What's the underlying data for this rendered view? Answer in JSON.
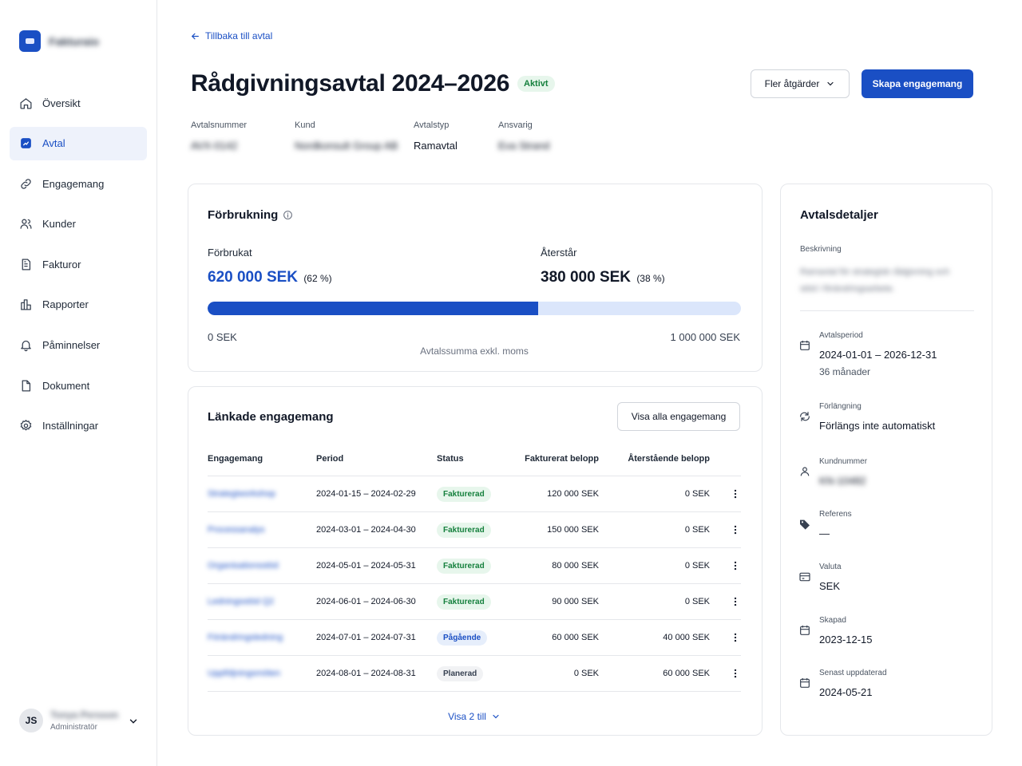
{
  "app": {
    "name": "Fakturaio"
  },
  "sidebar": {
    "items": [
      {
        "label": "Översikt",
        "icon": "home-icon"
      },
      {
        "label": "Avtal",
        "icon": "contract-icon",
        "active": true
      },
      {
        "label": "Engagemang",
        "icon": "link-icon"
      },
      {
        "label": "Kunder",
        "icon": "users-icon"
      },
      {
        "label": "Fakturor",
        "icon": "invoice-icon"
      },
      {
        "label": "Rapporter",
        "icon": "chart-icon"
      },
      {
        "label": "Påminnelser",
        "icon": "bell-icon"
      },
      {
        "label": "Dokument",
        "icon": "document-icon"
      },
      {
        "label": "Inställningar",
        "icon": "gear-icon"
      }
    ],
    "user": {
      "initials": "JS",
      "name": "Tonya Persson",
      "role": "Administratör"
    }
  },
  "header": {
    "back_label": "Tillbaka till avtal",
    "title": "Rådgivningsavtal 2024–2026",
    "status": "Aktivt",
    "more_actions": "Fler åtgärder",
    "create": "Skapa engagemang"
  },
  "meta": {
    "number": {
      "label": "Avtalsnummer",
      "value": "AVX-0142"
    },
    "customer": {
      "label": "Kund",
      "value": "Nordkonsult Group AB"
    },
    "type": {
      "label": "Avtalstyp",
      "value": "Ramavtal"
    },
    "owner": {
      "label": "Ansvarig",
      "value": "Eva Strand"
    }
  },
  "usage": {
    "title": "Förbrukning",
    "used_label": "Förbrukat",
    "used_value": "620 000 SEK",
    "used_pct": "(62 %)",
    "used_fraction": 0.62,
    "remaining_label": "Återstår",
    "remaining_value": "380 000 SEK",
    "remaining_pct": "(38 %)",
    "min": "0 SEK",
    "max": "1 000 000 SEK",
    "caption": "Avtalssumma exkl. moms"
  },
  "linked": {
    "title": "Länkade engagemang",
    "view_all": "Visa alla engagemang",
    "columns": [
      "Engagemang",
      "Period",
      "Status",
      "Fakturerat belopp",
      "Återstående belopp"
    ],
    "rows": [
      {
        "name": "Strategiworkshop",
        "period": "2024-01-15 – 2024-02-29",
        "status": "Fakturerad",
        "tone": "green",
        "billed": "120 000 SEK",
        "remaining": "0 SEK"
      },
      {
        "name": "Processanalys",
        "period": "2024-03-01 – 2024-04-30",
        "status": "Fakturerad",
        "tone": "green",
        "billed": "150 000 SEK",
        "remaining": "0 SEK"
      },
      {
        "name": "Organisationsstöd",
        "period": "2024-05-01 – 2024-05-31",
        "status": "Fakturerad",
        "tone": "green",
        "billed": "80 000 SEK",
        "remaining": "0 SEK"
      },
      {
        "name": "Ledningsstöd Q2",
        "period": "2024-06-01 – 2024-06-30",
        "status": "Fakturerad",
        "tone": "green",
        "billed": "90 000 SEK",
        "remaining": "0 SEK"
      },
      {
        "name": "Förändringsledning",
        "period": "2024-07-01 – 2024-07-31",
        "status": "Pågående",
        "tone": "blue",
        "billed": "60 000 SEK",
        "remaining": "40 000 SEK"
      },
      {
        "name": "Uppföljningsmöten",
        "period": "2024-08-01 – 2024-08-31",
        "status": "Planerad",
        "tone": "gray",
        "billed": "0 SEK",
        "remaining": "60 000 SEK"
      }
    ],
    "show_more": "Visa 2 till"
  },
  "details": {
    "title": "Avtalsdetaljer",
    "description_label": "Beskrivning",
    "description": "Ramavtal för strategisk rådgivning och stöd i förändringsarbete.",
    "period": {
      "label": "Avtalsperiod",
      "value": "2024-01-01 – 2026-12-31",
      "sub": "36 månader"
    },
    "renewal": {
      "label": "Förlängning",
      "value": "Förlängs inte automatiskt"
    },
    "customer_no": {
      "label": "Kundnummer",
      "value": "KN-10482"
    },
    "reference": {
      "label": "Referens",
      "value": "—"
    },
    "currency": {
      "label": "Valuta",
      "value": "SEK"
    },
    "created": {
      "label": "Skapad",
      "value": "2023-12-15"
    },
    "updated": {
      "label": "Senast uppdaterad",
      "value": "2024-05-21"
    }
  },
  "colors": {
    "accent": "#1a4fc4",
    "success": "#15803d",
    "progress_track": "#dbe6fb"
  }
}
